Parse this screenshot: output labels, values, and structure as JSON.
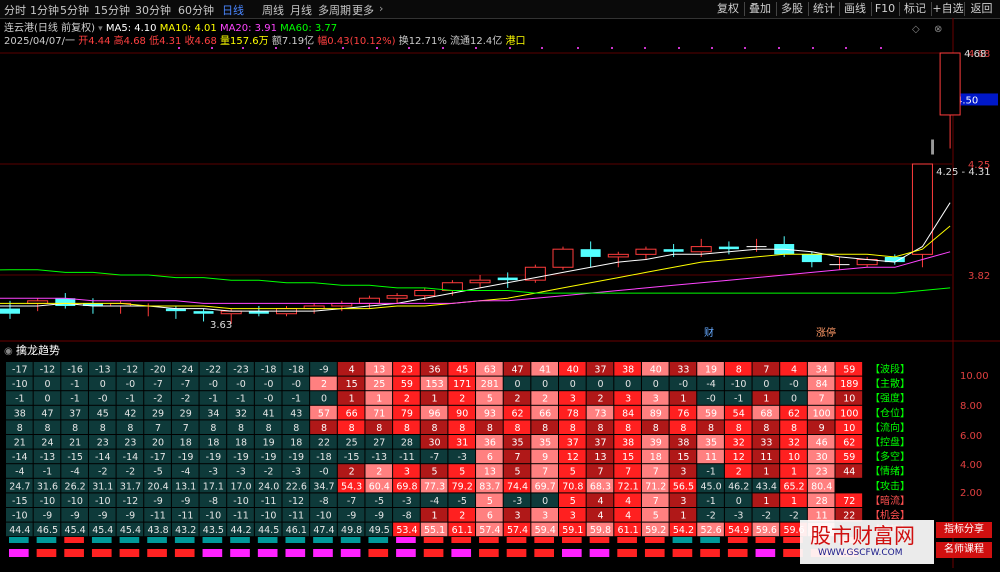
{
  "topbar": {
    "periods": [
      "分时",
      "1分钟",
      "5分钟",
      "15分钟",
      "30分钟",
      "60分钟",
      "日线",
      "周线",
      "月线",
      "多周期",
      "更多"
    ],
    "active_period": "日线",
    "more_arrow": "›",
    "right_buttons": [
      "复权",
      "叠加",
      "多股",
      "统计",
      "画线",
      "F10",
      "标记",
      "+自选",
      "返回"
    ]
  },
  "colors": {
    "up": "#ff3c3c",
    "down": "#54ffff",
    "ma5": "#ffffff",
    "ma10": "#ffff00",
    "ma20": "#ff44ff",
    "ma60": "#00ff00",
    "grid": "#6a0000",
    "axis_red": "#e04040"
  },
  "main_chart": {
    "header": {
      "name": "连云港(日线 前复权)",
      "ma5_label": "MA5: 4.10",
      "ma10_label": "MA10: 4.01",
      "ma20_label": "MA20: 3.91",
      "ma60_label": "MA60: 3.77"
    },
    "quote": {
      "date": "2025/04/07/一",
      "open_label": "开",
      "open": "4.44",
      "high_label": "高",
      "high": "4.68",
      "low_label": "低",
      "low": "4.31",
      "close_label": "收",
      "close": "4.68",
      "vol_label": "量",
      "vol": "157.6万",
      "amt_label": "额",
      "amt": "7.19亿",
      "chg_label": "幅",
      "chg": "0.43(10.12%)",
      "turn_label": "换",
      "turn": "12.71%",
      "float_label": "流通",
      "float": "12.4亿",
      "tag": "港口"
    },
    "y_axis_labels": [
      "4.68",
      "4.25",
      "3.82"
    ],
    "current_price_tag": "4.50",
    "annotations": {
      "high": "4.68",
      "gap": "4.25 - 4.31",
      "low": "3.63"
    },
    "markers": [
      "财",
      "涨停"
    ]
  },
  "chart_data": {
    "type": "candlestick",
    "y_ticks": [
      4.68,
      4.5,
      4.25,
      3.82
    ],
    "ylim": [
      3.55,
      4.78
    ],
    "candles": [
      {
        "o": 3.69,
        "h": 3.72,
        "l": 3.65,
        "c": 3.67
      },
      {
        "o": 3.71,
        "h": 3.73,
        "l": 3.68,
        "c": 3.72
      },
      {
        "o": 3.73,
        "h": 3.75,
        "l": 3.69,
        "c": 3.7
      },
      {
        "o": 3.71,
        "h": 3.73,
        "l": 3.67,
        "c": 3.7
      },
      {
        "o": 3.7,
        "h": 3.72,
        "l": 3.67,
        "c": 3.71
      },
      {
        "o": 3.7,
        "h": 3.71,
        "l": 3.66,
        "c": 3.7
      },
      {
        "o": 3.69,
        "h": 3.7,
        "l": 3.65,
        "c": 3.68
      },
      {
        "o": 3.68,
        "h": 3.69,
        "l": 3.64,
        "c": 3.67
      },
      {
        "o": 3.67,
        "h": 3.69,
        "l": 3.63,
        "c": 3.68
      },
      {
        "o": 3.68,
        "h": 3.7,
        "l": 3.66,
        "c": 3.67
      },
      {
        "o": 3.67,
        "h": 3.7,
        "l": 3.66,
        "c": 3.69
      },
      {
        "o": 3.69,
        "h": 3.71,
        "l": 3.67,
        "c": 3.7
      },
      {
        "o": 3.7,
        "h": 3.72,
        "l": 3.68,
        "c": 3.71
      },
      {
        "o": 3.71,
        "h": 3.74,
        "l": 3.69,
        "c": 3.73
      },
      {
        "o": 3.73,
        "h": 3.75,
        "l": 3.71,
        "c": 3.74
      },
      {
        "o": 3.74,
        "h": 3.77,
        "l": 3.72,
        "c": 3.76
      },
      {
        "o": 3.76,
        "h": 3.8,
        "l": 3.74,
        "c": 3.79
      },
      {
        "o": 3.79,
        "h": 3.82,
        "l": 3.77,
        "c": 3.8
      },
      {
        "o": 3.81,
        "h": 3.83,
        "l": 3.77,
        "c": 3.8
      },
      {
        "o": 3.8,
        "h": 3.86,
        "l": 3.79,
        "c": 3.85
      },
      {
        "o": 3.85,
        "h": 3.93,
        "l": 3.84,
        "c": 3.92
      },
      {
        "o": 3.92,
        "h": 3.95,
        "l": 3.85,
        "c": 3.89
      },
      {
        "o": 3.89,
        "h": 3.91,
        "l": 3.85,
        "c": 3.9
      },
      {
        "o": 3.9,
        "h": 3.93,
        "l": 3.88,
        "c": 3.92
      },
      {
        "o": 3.92,
        "h": 3.94,
        "l": 3.89,
        "c": 3.91
      },
      {
        "o": 3.91,
        "h": 3.96,
        "l": 3.89,
        "c": 3.93
      },
      {
        "o": 3.93,
        "h": 3.95,
        "l": 3.9,
        "c": 3.92
      },
      {
        "o": 3.93,
        "h": 3.96,
        "l": 3.91,
        "c": 3.93
      },
      {
        "o": 3.94,
        "h": 3.97,
        "l": 3.89,
        "c": 3.9
      },
      {
        "o": 3.9,
        "h": 3.91,
        "l": 3.85,
        "c": 3.87
      },
      {
        "o": 3.86,
        "h": 3.89,
        "l": 3.84,
        "c": 3.86
      },
      {
        "o": 3.86,
        "h": 3.89,
        "l": 3.85,
        "c": 3.88
      },
      {
        "o": 3.89,
        "h": 3.9,
        "l": 3.86,
        "c": 3.87
      },
      {
        "o": 3.9,
        "h": 4.25,
        "l": 3.85,
        "c": 4.25
      },
      {
        "o": 4.44,
        "h": 4.68,
        "l": 4.31,
        "c": 4.68
      }
    ],
    "ma": {
      "MA5": [
        3.7,
        3.7,
        3.71,
        3.7,
        3.7,
        3.7,
        3.69,
        3.69,
        3.68,
        3.68,
        3.68,
        3.68,
        3.69,
        3.7,
        3.71,
        3.73,
        3.75,
        3.77,
        3.79,
        3.81,
        3.83,
        3.85,
        3.87,
        3.88,
        3.9,
        3.9,
        3.91,
        3.92,
        3.92,
        3.91,
        3.89,
        3.88,
        3.87,
        3.93,
        4.1
      ],
      "MA10": [
        3.71,
        3.71,
        3.71,
        3.71,
        3.71,
        3.7,
        3.7,
        3.7,
        3.69,
        3.69,
        3.69,
        3.69,
        3.69,
        3.69,
        3.7,
        3.7,
        3.71,
        3.72,
        3.73,
        3.75,
        3.77,
        3.79,
        3.81,
        3.83,
        3.85,
        3.87,
        3.88,
        3.89,
        3.9,
        3.9,
        3.9,
        3.9,
        3.89,
        3.92,
        4.01
      ],
      "MA20": [
        3.73,
        3.73,
        3.73,
        3.72,
        3.72,
        3.72,
        3.72,
        3.71,
        3.71,
        3.71,
        3.71,
        3.71,
        3.71,
        3.71,
        3.71,
        3.71,
        3.71,
        3.72,
        3.72,
        3.73,
        3.74,
        3.75,
        3.76,
        3.77,
        3.78,
        3.79,
        3.8,
        3.81,
        3.82,
        3.83,
        3.84,
        3.85,
        3.85,
        3.88,
        3.91
      ],
      "MA60": [
        3.84,
        3.84,
        3.83,
        3.83,
        3.82,
        3.82,
        3.81,
        3.81,
        3.8,
        3.8,
        3.79,
        3.79,
        3.78,
        3.78,
        3.77,
        3.77,
        3.76,
        3.76,
        3.76,
        3.75,
        3.75,
        3.75,
        3.75,
        3.75,
        3.75,
        3.75,
        3.75,
        3.75,
        3.75,
        3.75,
        3.75,
        3.75,
        3.75,
        3.76,
        3.77
      ]
    }
  },
  "sub_chart": {
    "title": "擒龙趋势",
    "y_axis_labels": [
      "10.00",
      "8.00",
      "6.00",
      "4.00",
      "2.00"
    ],
    "row_labels": [
      "【波段】",
      "【主散】",
      "【强度】",
      "【仓位】",
      "【流向】",
      "【控盘】",
      "【多空】",
      "【情绪】",
      "【攻击】",
      "【暗流】",
      "【机会】",
      "【趋势】"
    ],
    "rows": [
      [
        "-17",
        "-12",
        "-16",
        "-13",
        "-12",
        "-20",
        "-24",
        "-22",
        "-23",
        "-18",
        "-18",
        "-9",
        "4",
        "13",
        "23",
        "36",
        "45",
        "63",
        "47",
        "41",
        "40",
        "37",
        "38",
        "40",
        "33",
        "19",
        "8",
        "7",
        "4",
        "34",
        "59"
      ],
      [
        "-10",
        "0",
        "-1",
        "0",
        "-0",
        "-7",
        "-7",
        "-0",
        "-0",
        "-0",
        "-0",
        "2",
        "15",
        "25",
        "59",
        "153",
        "171",
        "281",
        "0",
        "0",
        "0",
        "0",
        "0",
        "0",
        "-0",
        "-4",
        "-10",
        "0",
        "-0",
        "84",
        "189"
      ],
      [
        "-1",
        "0",
        "-1",
        "-0",
        "-1",
        "-2",
        "-2",
        "-1",
        "-1",
        "-0",
        "-1",
        "0",
        "1",
        "1",
        "2",
        "1",
        "2",
        "5",
        "2",
        "2",
        "3",
        "2",
        "3",
        "3",
        "1",
        "-0",
        "-1",
        "1",
        "0",
        "7",
        "10"
      ],
      [
        "38",
        "47",
        "37",
        "45",
        "42",
        "29",
        "29",
        "34",
        "32",
        "41",
        "43",
        "57",
        "66",
        "71",
        "79",
        "96",
        "90",
        "93",
        "62",
        "66",
        "78",
        "73",
        "84",
        "89",
        "76",
        "59",
        "54",
        "68",
        "62",
        "100",
        "100"
      ],
      [
        "8",
        "8",
        "8",
        "8",
        "8",
        "7",
        "7",
        "8",
        "8",
        "8",
        "8",
        "8",
        "8",
        "8",
        "8",
        "8",
        "8",
        "8",
        "8",
        "8",
        "8",
        "8",
        "8",
        "8",
        "8",
        "8",
        "8",
        "8",
        "8",
        "9",
        "10"
      ],
      [
        "21",
        "24",
        "21",
        "23",
        "23",
        "20",
        "18",
        "18",
        "18",
        "19",
        "18",
        "22",
        "25",
        "27",
        "28",
        "30",
        "31",
        "36",
        "35",
        "35",
        "37",
        "37",
        "38",
        "39",
        "38",
        "35",
        "32",
        "33",
        "32",
        "46",
        "62"
      ],
      [
        "-14",
        "-13",
        "-15",
        "-14",
        "-14",
        "-17",
        "-19",
        "-19",
        "-19",
        "-19",
        "-19",
        "-18",
        "-15",
        "-13",
        "-11",
        "-7",
        "-3",
        "6",
        "7",
        "9",
        "12",
        "13",
        "15",
        "18",
        "15",
        "11",
        "12",
        "11",
        "10",
        "30",
        "59"
      ],
      [
        "-4",
        "-1",
        "-4",
        "-2",
        "-2",
        "-5",
        "-4",
        "-3",
        "-3",
        "-2",
        "-3",
        "-0",
        "2",
        "2",
        "3",
        "5",
        "5",
        "13",
        "5",
        "7",
        "5",
        "7",
        "7",
        "7",
        "3",
        "-1",
        "2",
        "1",
        "1",
        "23",
        "44"
      ],
      [
        "24.7",
        "31.6",
        "26.2",
        "31.1",
        "31.7",
        "20.4",
        "13.1",
        "17.1",
        "17.0",
        "24.0",
        "22.6",
        "34.7",
        "54.3",
        "60.4",
        "69.8",
        "77.3",
        "79.2",
        "83.7",
        "74.4",
        "69.7",
        "70.8",
        "68.3",
        "72.1",
        "71.2",
        "56.5",
        "45.0",
        "46.2",
        "43.4",
        "65.2",
        "80.4"
      ],
      [
        "-15",
        "-10",
        "-10",
        "-10",
        "-12",
        "-9",
        "-9",
        "-8",
        "-10",
        "-11",
        "-12",
        "-8",
        "-7",
        "-5",
        "-3",
        "-4",
        "-5",
        "5",
        "-3",
        "0",
        "5",
        "4",
        "4",
        "7",
        "3",
        "-1",
        "0",
        "1",
        "1",
        "28",
        "72"
      ],
      [
        "-10",
        "-9",
        "-9",
        "-9",
        "-9",
        "-11",
        "-11",
        "-10",
        "-11",
        "-10",
        "-11",
        "-10",
        "-9",
        "-9",
        "-8",
        "1",
        "2",
        "6",
        "3",
        "3",
        "3",
        "4",
        "4",
        "5",
        "1",
        "-2",
        "-3",
        "-2",
        "-2",
        "11",
        "22"
      ],
      [
        "44.4",
        "46.5",
        "45.4",
        "45.4",
        "45.4",
        "43.8",
        "43.2",
        "43.5",
        "44.2",
        "44.5",
        "46.1",
        "47.4",
        "49.8",
        "49.5",
        "53.4",
        "55.1",
        "61.1",
        "57.4",
        "57.4",
        "59.4",
        "59.1",
        "59.8",
        "61.1",
        "59.2",
        "54.2",
        "52.6",
        "54.9",
        "59.6",
        "59.6",
        "60.5"
      ]
    ],
    "bottom_bars": [
      [
        "cyan",
        "magenta"
      ],
      [
        "cyan",
        "red"
      ],
      [
        "red",
        "red"
      ],
      [
        "cyan",
        "red"
      ],
      [
        "cyan",
        "red"
      ],
      [
        "cyan",
        "red"
      ],
      [
        "cyan",
        "red"
      ],
      [
        "cyan",
        "magenta"
      ],
      [
        "cyan",
        "magenta"
      ],
      [
        "cyan",
        "magenta"
      ],
      [
        "cyan",
        "magenta"
      ],
      [
        "cyan",
        "magenta"
      ],
      [
        "cyan",
        "magenta"
      ],
      [
        "cyan",
        "red"
      ],
      [
        "magenta",
        "magenta"
      ],
      [
        "red",
        "red"
      ],
      [
        "red",
        "magenta"
      ],
      [
        "red",
        "red"
      ],
      [
        "red",
        "red"
      ],
      [
        "red",
        "red"
      ],
      [
        "red",
        "magenta"
      ],
      [
        "red",
        "magenta"
      ],
      [
        "red",
        "red"
      ],
      [
        "red",
        "red"
      ],
      [
        "cyan",
        "red"
      ],
      [
        "cyan",
        "red"
      ],
      [
        "red",
        "red"
      ],
      [
        "red",
        "magenta"
      ],
      [
        "red",
        "red"
      ],
      [
        "red",
        "red"
      ],
      [
        "red",
        "red"
      ]
    ]
  },
  "watermark": {
    "title": "股市财富网",
    "url": "WWW.GSCFW.COM",
    "tag1": "指标分享",
    "tag2": "名师课程"
  }
}
